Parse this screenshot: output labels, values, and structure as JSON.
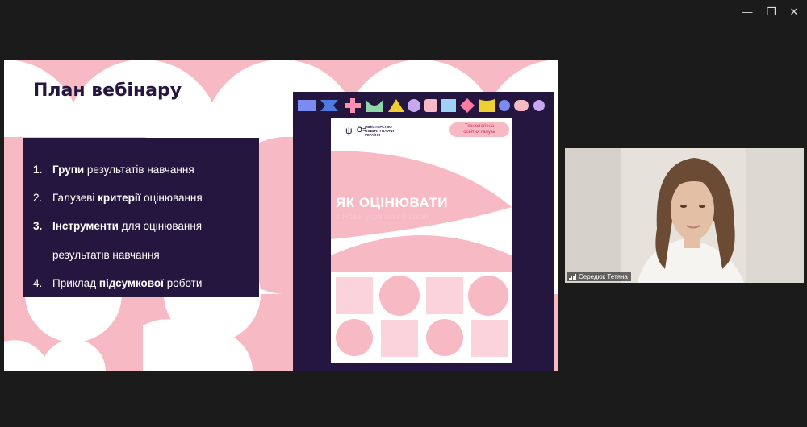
{
  "window": {
    "minimize_glyph": "—",
    "restore_glyph": "❐",
    "close_glyph": "✕"
  },
  "slide": {
    "title": "План вебінару",
    "agenda": [
      {
        "num": "1.",
        "bold_num": true,
        "parts": [
          {
            "t": "Групи",
            "b": true
          },
          {
            "t": " результатів навчання",
            "b": false
          }
        ]
      },
      {
        "num": "2.",
        "bold_num": false,
        "parts": [
          {
            "t": "Галузеві ",
            "b": false
          },
          {
            "t": "критерії",
            "b": true
          },
          {
            "t": " оцінювання",
            "b": false
          }
        ]
      },
      {
        "num": "3.",
        "bold_num": true,
        "parts": [
          {
            "t": "Інструменти",
            "b": true
          },
          {
            "t": " для оцінювання",
            "b": false
          }
        ]
      },
      {
        "num": "",
        "bold_num": false,
        "parts": [
          {
            "t": "результатів навчання",
            "b": false
          }
        ]
      },
      {
        "num": "4.",
        "bold_num": false,
        "parts": [
          {
            "t": "Приклад ",
            "b": false
          },
          {
            "t": "підсумкової",
            "b": true
          },
          {
            "t": " роботи",
            "b": false
          }
        ]
      }
    ],
    "book": {
      "ministry": [
        "МІНІСТЕРСТВО",
        "ОСВІТИ І НАУКИ",
        "УКРАЇНИ"
      ],
      "logo_mark": "О≡",
      "domain_badge": [
        "Технологічна",
        "освітня галузь"
      ],
      "title": "ЯК ОЦІНЮВАТИ",
      "subtitle": "в Новій українській школі"
    }
  },
  "video": {
    "participant_name": "Середюк Тетяна"
  },
  "colors": {
    "navy": "#24163f",
    "pink": "#f7b9c3",
    "pink_light": "#fbd3da"
  }
}
